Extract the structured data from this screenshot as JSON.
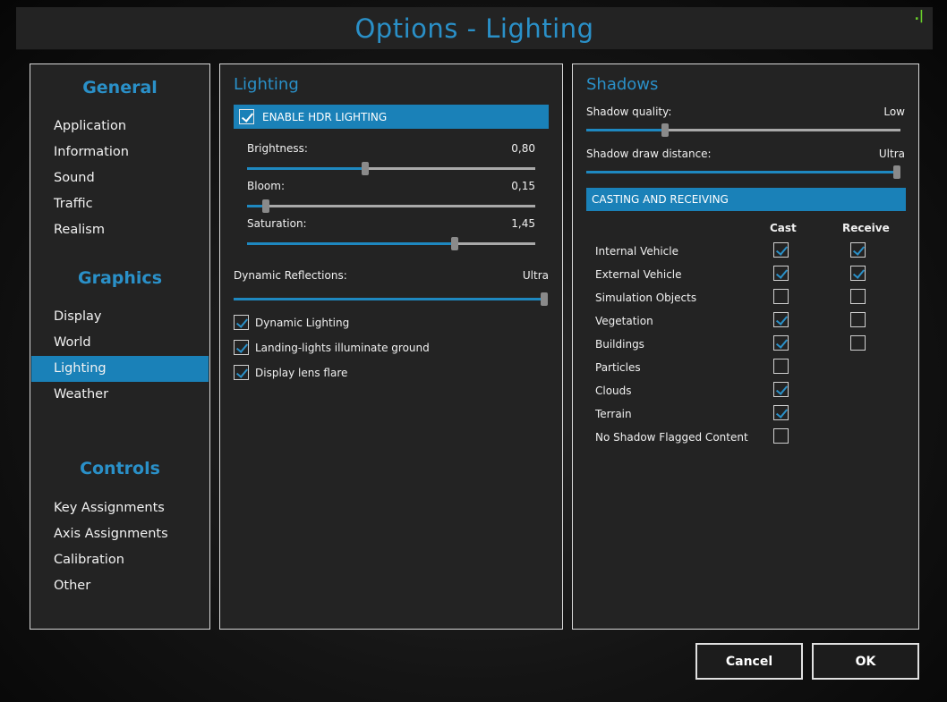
{
  "window": {
    "title": "Options - Lighting",
    "corner_mark": ".|"
  },
  "nav": {
    "general": {
      "heading": "General",
      "items": [
        "Application",
        "Information",
        "Sound",
        "Traffic",
        "Realism"
      ]
    },
    "graphics": {
      "heading": "Graphics",
      "items": [
        "Display",
        "World",
        "Lighting",
        "Weather"
      ],
      "active": "Lighting"
    },
    "controls": {
      "heading": "Controls",
      "items": [
        "Key Assignments",
        "Axis Assignments",
        "Calibration",
        "Other"
      ]
    }
  },
  "lighting": {
    "title": "Lighting",
    "hdr": {
      "label": "ENABLE HDR LIGHTING",
      "checked": true
    },
    "sliders": [
      {
        "label": "Brightness:",
        "value": "0,80",
        "fraction": 0.41
      },
      {
        "label": "Bloom:",
        "value": "0,15",
        "fraction": 0.065
      },
      {
        "label": "Saturation:",
        "value": "1,45",
        "fraction": 0.72
      }
    ],
    "reflections": {
      "label": "Dynamic Reflections:",
      "value": "Ultra",
      "fraction": 1.0
    },
    "checkboxes": [
      {
        "label": "Dynamic Lighting",
        "checked": true
      },
      {
        "label": "Landing-lights illuminate ground",
        "checked": true
      },
      {
        "label": "Display lens flare",
        "checked": true
      }
    ]
  },
  "shadows": {
    "title": "Shadows",
    "quality": {
      "label": "Shadow quality:",
      "value": "Low",
      "fraction": 0.25
    },
    "distance": {
      "label": "Shadow draw distance:",
      "value": "Ultra",
      "fraction": 1.0
    },
    "casting_header": "CASTING AND RECEIVING",
    "col_cast": "Cast",
    "col_receive": "Receive",
    "rows": [
      {
        "label": "Internal Vehicle",
        "cast": true,
        "receive": true
      },
      {
        "label": "External Vehicle",
        "cast": true,
        "receive": true
      },
      {
        "label": "Simulation Objects",
        "cast": false,
        "receive": false
      },
      {
        "label": "Vegetation",
        "cast": true,
        "receive": false
      },
      {
        "label": "Buildings",
        "cast": true,
        "receive": false
      },
      {
        "label": "Particles",
        "cast": false,
        "receive": null
      },
      {
        "label": "Clouds",
        "cast": true,
        "receive": null
      },
      {
        "label": "Terrain",
        "cast": true,
        "receive": null
      },
      {
        "label": "No Shadow Flagged Content",
        "cast": false,
        "receive": null
      }
    ]
  },
  "buttons": {
    "cancel": "Cancel",
    "ok": "OK"
  },
  "colors": {
    "accent": "#1a81b8",
    "heading": "#2a90c8",
    "panel": "#232323"
  }
}
